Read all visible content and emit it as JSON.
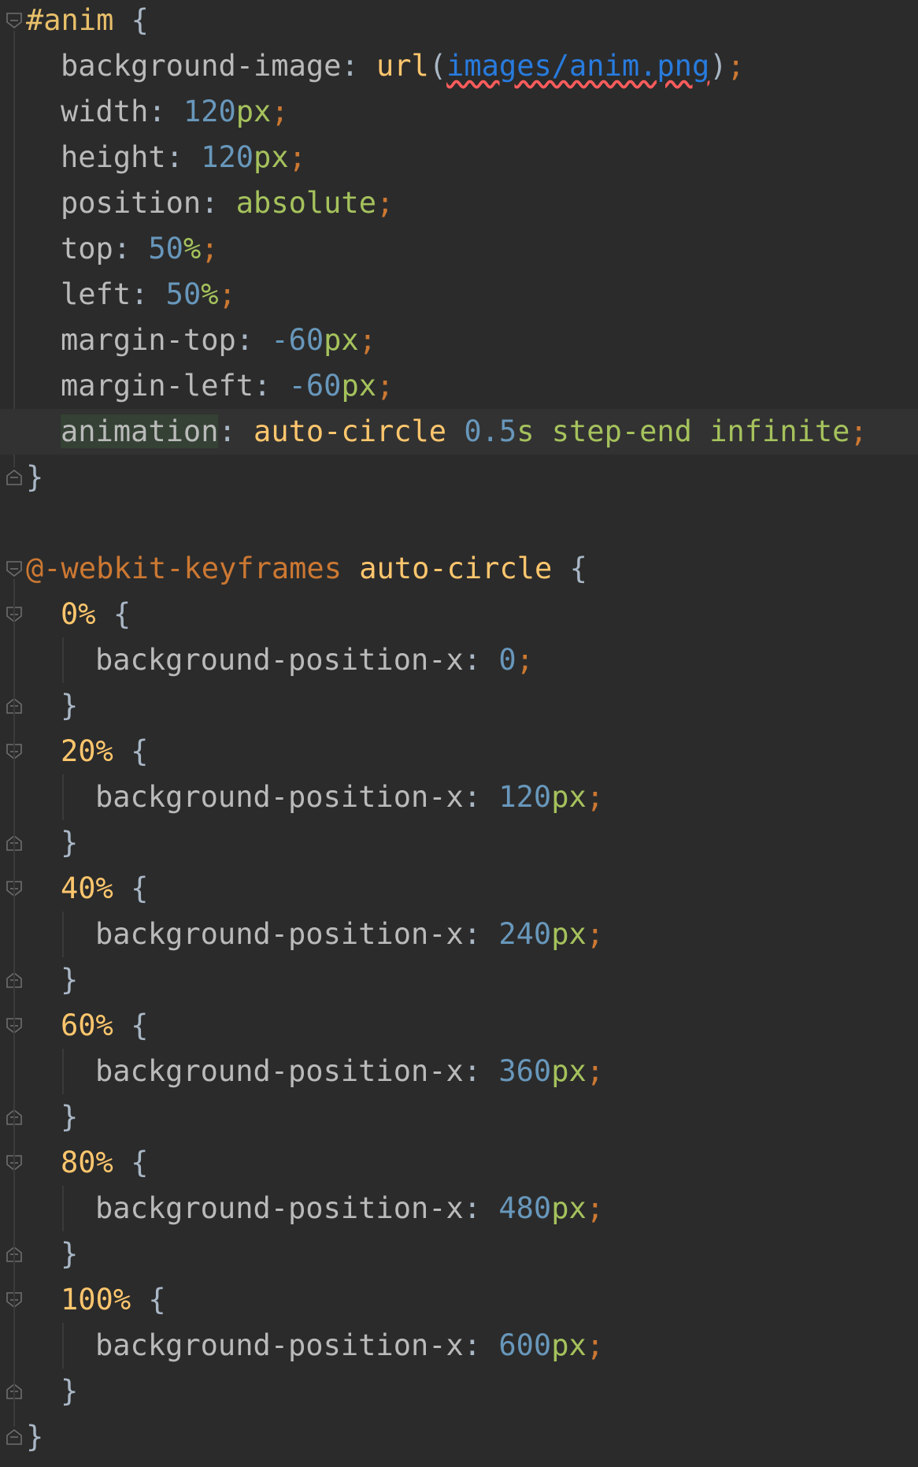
{
  "editor": {
    "colors": {
      "background": "#2b2b2b",
      "current_line": "#323232",
      "property": "#bababa",
      "selector": "#e8bf6a",
      "function": "#ffc66d",
      "url": "#287bde",
      "number": "#6897bb",
      "unit_and_keyword": "#a5c25c",
      "semicolon_and_at_rule": "#cc7832",
      "error_underline": "#ff5c5c"
    },
    "lines": [
      {
        "tokens": [
          {
            "t": "#anim",
            "c": "sel"
          },
          {
            "t": " {",
            "c": "punc"
          }
        ]
      },
      {
        "tokens": [
          {
            "t": "background-image",
            "c": "prop"
          },
          {
            "t": ": ",
            "c": "punc"
          },
          {
            "t": "url",
            "c": "func"
          },
          {
            "t": "(",
            "c": "punc"
          },
          {
            "t": "images/anim.png",
            "c": "link"
          },
          {
            "t": ")",
            "c": "punc"
          },
          {
            "t": ";",
            "c": "semi"
          }
        ]
      },
      {
        "tokens": [
          {
            "t": "width",
            "c": "prop"
          },
          {
            "t": ": ",
            "c": "punc"
          },
          {
            "t": "120",
            "c": "num"
          },
          {
            "t": "px",
            "c": "unit"
          },
          {
            "t": ";",
            "c": "semi"
          }
        ]
      },
      {
        "tokens": [
          {
            "t": "height",
            "c": "prop"
          },
          {
            "t": ": ",
            "c": "punc"
          },
          {
            "t": "120",
            "c": "num"
          },
          {
            "t": "px",
            "c": "unit"
          },
          {
            "t": ";",
            "c": "semi"
          }
        ]
      },
      {
        "tokens": [
          {
            "t": "position",
            "c": "prop"
          },
          {
            "t": ": ",
            "c": "punc"
          },
          {
            "t": "absolute",
            "c": "kw"
          },
          {
            "t": ";",
            "c": "semi"
          }
        ]
      },
      {
        "tokens": [
          {
            "t": "top",
            "c": "prop"
          },
          {
            "t": ": ",
            "c": "punc"
          },
          {
            "t": "50",
            "c": "num"
          },
          {
            "t": "%",
            "c": "unit"
          },
          {
            "t": ";",
            "c": "semi"
          }
        ]
      },
      {
        "tokens": [
          {
            "t": "left",
            "c": "prop"
          },
          {
            "t": ": ",
            "c": "punc"
          },
          {
            "t": "50",
            "c": "num"
          },
          {
            "t": "%",
            "c": "unit"
          },
          {
            "t": ";",
            "c": "semi"
          }
        ]
      },
      {
        "tokens": [
          {
            "t": "margin-top",
            "c": "prop"
          },
          {
            "t": ": ",
            "c": "punc"
          },
          {
            "t": "-60",
            "c": "num"
          },
          {
            "t": "px",
            "c": "unit"
          },
          {
            "t": ";",
            "c": "semi"
          }
        ]
      },
      {
        "tokens": [
          {
            "t": "margin-left",
            "c": "prop"
          },
          {
            "t": ": ",
            "c": "punc"
          },
          {
            "t": "-60",
            "c": "num"
          },
          {
            "t": "px",
            "c": "unit"
          },
          {
            "t": ";",
            "c": "semi"
          }
        ]
      },
      {
        "tokens": [
          {
            "t": "animation",
            "c": "anim"
          },
          {
            "t": ": ",
            "c": "punc"
          },
          {
            "t": "auto-circle ",
            "c": "func"
          },
          {
            "t": "0.5",
            "c": "num"
          },
          {
            "t": "s",
            "c": "unit"
          },
          {
            "t": " step-end infinite",
            "c": "kw"
          },
          {
            "t": ";",
            "c": "semi"
          }
        ]
      },
      {
        "tokens": [
          {
            "t": "}",
            "c": "punc"
          }
        ]
      },
      {
        "tokens": []
      },
      {
        "tokens": [
          {
            "t": "@-webkit-keyframes",
            "c": "at"
          },
          {
            "t": " ",
            "c": "punc"
          },
          {
            "t": "auto-circle",
            "c": "fname"
          },
          {
            "t": " {",
            "c": "punc"
          }
        ]
      },
      {
        "tokens": [
          {
            "t": "0%",
            "c": "pct"
          },
          {
            "t": " {",
            "c": "punc"
          }
        ]
      },
      {
        "tokens": [
          {
            "t": "background-position-x",
            "c": "prop"
          },
          {
            "t": ": ",
            "c": "punc"
          },
          {
            "t": "0",
            "c": "num"
          },
          {
            "t": ";",
            "c": "semi"
          }
        ]
      },
      {
        "tokens": [
          {
            "t": "}",
            "c": "punc"
          }
        ]
      },
      {
        "tokens": [
          {
            "t": "20%",
            "c": "pct"
          },
          {
            "t": " {",
            "c": "punc"
          }
        ]
      },
      {
        "tokens": [
          {
            "t": "background-position-x",
            "c": "prop"
          },
          {
            "t": ": ",
            "c": "punc"
          },
          {
            "t": "120",
            "c": "num"
          },
          {
            "t": "px",
            "c": "unit"
          },
          {
            "t": ";",
            "c": "semi"
          }
        ]
      },
      {
        "tokens": [
          {
            "t": "}",
            "c": "punc"
          }
        ]
      },
      {
        "tokens": [
          {
            "t": "40%",
            "c": "pct"
          },
          {
            "t": " {",
            "c": "punc"
          }
        ]
      },
      {
        "tokens": [
          {
            "t": "background-position-x",
            "c": "prop"
          },
          {
            "t": ": ",
            "c": "punc"
          },
          {
            "t": "240",
            "c": "num"
          },
          {
            "t": "px",
            "c": "unit"
          },
          {
            "t": ";",
            "c": "semi"
          }
        ]
      },
      {
        "tokens": [
          {
            "t": "}",
            "c": "punc"
          }
        ]
      },
      {
        "tokens": [
          {
            "t": "60%",
            "c": "pct"
          },
          {
            "t": " {",
            "c": "punc"
          }
        ]
      },
      {
        "tokens": [
          {
            "t": "background-position-x",
            "c": "prop"
          },
          {
            "t": ": ",
            "c": "punc"
          },
          {
            "t": "360",
            "c": "num"
          },
          {
            "t": "px",
            "c": "unit"
          },
          {
            "t": ";",
            "c": "semi"
          }
        ]
      },
      {
        "tokens": [
          {
            "t": "}",
            "c": "punc"
          }
        ]
      },
      {
        "tokens": [
          {
            "t": "80%",
            "c": "pct"
          },
          {
            "t": " {",
            "c": "punc"
          }
        ]
      },
      {
        "tokens": [
          {
            "t": "background-position-x",
            "c": "prop"
          },
          {
            "t": ": ",
            "c": "punc"
          },
          {
            "t": "480",
            "c": "num"
          },
          {
            "t": "px",
            "c": "unit"
          },
          {
            "t": ";",
            "c": "semi"
          }
        ]
      },
      {
        "tokens": [
          {
            "t": "}",
            "c": "punc"
          }
        ]
      },
      {
        "tokens": [
          {
            "t": "100%",
            "c": "pct"
          },
          {
            "t": " {",
            "c": "punc"
          }
        ]
      },
      {
        "tokens": [
          {
            "t": "background-position-x",
            "c": "prop"
          },
          {
            "t": ": ",
            "c": "punc"
          },
          {
            "t": "600",
            "c": "num"
          },
          {
            "t": "px",
            "c": "unit"
          },
          {
            "t": ";",
            "c": "semi"
          }
        ]
      },
      {
        "tokens": [
          {
            "t": "}",
            "c": "punc"
          }
        ]
      },
      {
        "tokens": [
          {
            "t": "}",
            "c": "punc"
          }
        ]
      }
    ]
  }
}
